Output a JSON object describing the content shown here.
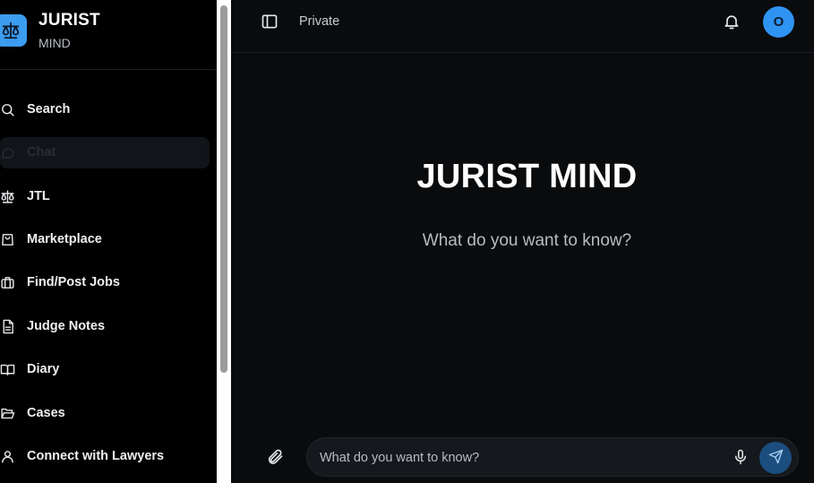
{
  "brand": {
    "title": "JURIST",
    "subtitle": "MIND",
    "logo_icon": "scales-icon"
  },
  "sidebar": {
    "items": [
      {
        "label": "Search",
        "icon": "search-icon",
        "active": false
      },
      {
        "label": "Chat",
        "icon": "chat-icon",
        "active": true
      },
      {
        "label": "JTL",
        "icon": "scales-icon",
        "active": false
      },
      {
        "label": "Marketplace",
        "icon": "shopping-bag-icon",
        "active": false
      },
      {
        "label": "Find/Post Jobs",
        "icon": "briefcase-icon",
        "active": false
      },
      {
        "label": "Judge Notes",
        "icon": "document-icon",
        "active": false
      },
      {
        "label": "Diary",
        "icon": "book-open-icon",
        "active": false
      },
      {
        "label": "Cases",
        "icon": "folder-open-icon",
        "active": false
      },
      {
        "label": "Connect with Lawyers",
        "icon": "user-icon",
        "active": false
      }
    ]
  },
  "topbar": {
    "title": "Private",
    "avatar_initial": "O"
  },
  "hero": {
    "title": "JURIST MIND",
    "subtitle": "What do you want to know?"
  },
  "composer": {
    "placeholder": "What do you want to know?",
    "value": ""
  },
  "colors": {
    "accent": "#2f93f2",
    "background": "#0a0b0d",
    "sidebar": "#000000",
    "send_button": "#1b4d7e"
  }
}
